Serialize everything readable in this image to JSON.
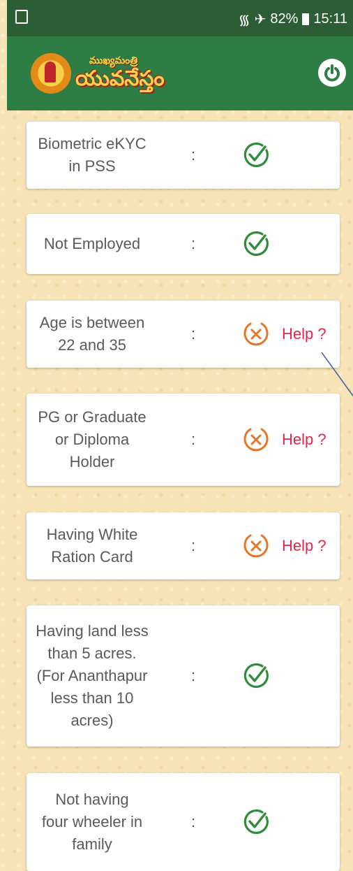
{
  "status_bar": {
    "battery": "82%",
    "time": "15:11"
  },
  "header": {
    "logo_small_text": "ముఖ్యమంత్రి",
    "logo_big_text": "యువనేస్తం",
    "power_icon": "power-icon"
  },
  "criteria": [
    {
      "label": "Biometric eKYC\nin PSS",
      "colon": ":",
      "status": "pass"
    },
    {
      "label": "Not Employed",
      "colon": ":",
      "status": "pass"
    },
    {
      "label": "Age is between\n22 and 35",
      "colon": ":",
      "status": "fail",
      "help": "Help ?"
    },
    {
      "label": "PG or Graduate\nor Diploma\nHolder",
      "colon": ":",
      "status": "fail",
      "help": "Help ?"
    },
    {
      "label": "Having White\nRation Card",
      "colon": ":",
      "status": "fail",
      "help": "Help ?"
    },
    {
      "label": "Having land less\nthan 5 acres.\n(For Ananthapur\nless than 10\nacres)",
      "colon": ":",
      "status": "pass"
    },
    {
      "label": "Not having\nfour wheeler in\nfamily",
      "colon": ":",
      "status": "pass"
    }
  ],
  "colors": {
    "pass": "#2e8b3a",
    "fail": "#e8742a",
    "help": "#e5254a",
    "appbar": "#2e7d44",
    "statusbar": "#2c5d35"
  }
}
